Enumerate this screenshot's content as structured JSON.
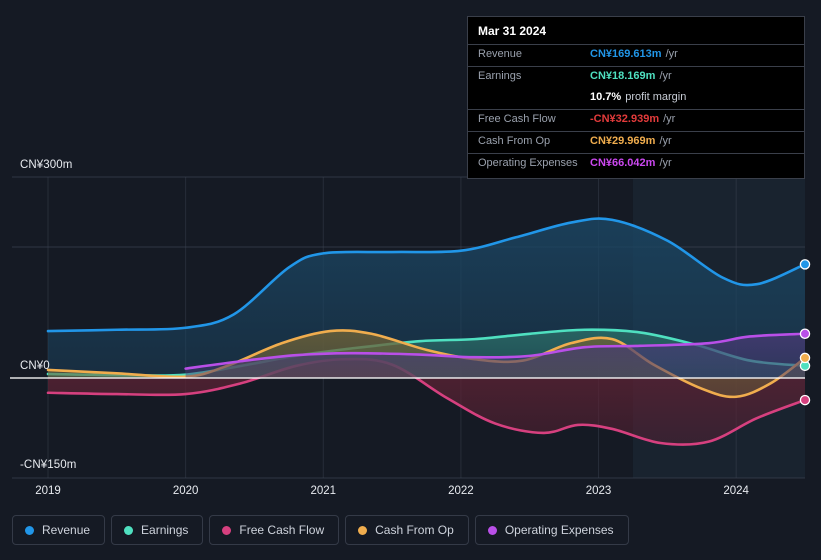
{
  "chart_data": {
    "type": "area",
    "title": "",
    "xlabel": "",
    "ylabel": "",
    "currency": "CN¥",
    "grid": true,
    "legend_position": "bottom",
    "x": [
      2019,
      2020,
      2021,
      2022,
      2023,
      2024
    ],
    "x_tick_labels": [
      "2019",
      "2020",
      "2021",
      "2022",
      "2023",
      "2024"
    ],
    "y_tick_labels": [
      "CN¥300m",
      "CN¥0",
      "-CN¥150m"
    ],
    "y_tick_values": [
      300,
      0,
      -150
    ],
    "ylim": [
      -150,
      300
    ],
    "zero_line": 0,
    "forecast_start": 2023.25,
    "series": [
      {
        "name": "Revenue",
        "color": "#2196e8",
        "fill": "#1b4562",
        "values": [
          70,
          75,
          186,
          190,
          236,
          169.613
        ],
        "points": [
          [
            2019.0,
            70
          ],
          [
            2019.5,
            72
          ],
          [
            2020.0,
            75
          ],
          [
            2020.35,
            95
          ],
          [
            2020.75,
            165
          ],
          [
            2021.0,
            186
          ],
          [
            2021.5,
            188
          ],
          [
            2022.0,
            190
          ],
          [
            2022.4,
            210
          ],
          [
            2022.8,
            232
          ],
          [
            2023.1,
            236
          ],
          [
            2023.5,
            205
          ],
          [
            2023.9,
            150
          ],
          [
            2024.15,
            140
          ],
          [
            2024.5,
            169.613
          ]
        ]
      },
      {
        "name": "Earnings",
        "color": "#4fe0c0",
        "fill": "#2a6b66",
        "values": [
          6,
          5,
          40,
          60,
          72,
          18.169
        ],
        "points": [
          [
            2019.0,
            6
          ],
          [
            2019.6,
            4
          ],
          [
            2020.0,
            5
          ],
          [
            2020.4,
            18
          ],
          [
            2020.8,
            33
          ],
          [
            2021.2,
            44
          ],
          [
            2021.7,
            55
          ],
          [
            2022.1,
            58
          ],
          [
            2022.5,
            66
          ],
          [
            2022.9,
            72
          ],
          [
            2023.3,
            68
          ],
          [
            2023.7,
            50
          ],
          [
            2024.1,
            26
          ],
          [
            2024.5,
            18.169
          ]
        ]
      },
      {
        "name": "Free Cash Flow",
        "color": "#d6407f",
        "fill": "#5c2234",
        "values": [
          -22,
          -24,
          28,
          -72,
          -95,
          -32.939
        ],
        "points": [
          [
            2019.0,
            -22
          ],
          [
            2019.5,
            -24
          ],
          [
            2020.0,
            -24
          ],
          [
            2020.4,
            -8
          ],
          [
            2020.8,
            18
          ],
          [
            2021.15,
            28
          ],
          [
            2021.5,
            20
          ],
          [
            2021.9,
            -30
          ],
          [
            2022.25,
            -68
          ],
          [
            2022.6,
            -82
          ],
          [
            2022.85,
            -70
          ],
          [
            2023.1,
            -76
          ],
          [
            2023.45,
            -97
          ],
          [
            2023.8,
            -95
          ],
          [
            2024.15,
            -60
          ],
          [
            2024.5,
            -32.939
          ]
        ]
      },
      {
        "name": "Cash From Op",
        "color": "#f0ad4e",
        "fill": "#6b6038",
        "values": [
          12,
          2,
          70,
          34,
          60,
          29.969
        ],
        "points": [
          [
            2019.0,
            12
          ],
          [
            2019.5,
            7
          ],
          [
            2020.0,
            2
          ],
          [
            2020.3,
            18
          ],
          [
            2020.7,
            52
          ],
          [
            2021.05,
            70
          ],
          [
            2021.35,
            66
          ],
          [
            2021.75,
            42
          ],
          [
            2022.1,
            28
          ],
          [
            2022.45,
            26
          ],
          [
            2022.8,
            52
          ],
          [
            2023.1,
            58
          ],
          [
            2023.4,
            20
          ],
          [
            2023.75,
            -16
          ],
          [
            2024.0,
            -28
          ],
          [
            2024.25,
            -8
          ],
          [
            2024.5,
            29.969
          ]
        ]
      },
      {
        "name": "Operating Expenses",
        "color": "#b94fe8",
        "fill": "#453a72",
        "values": [
          null,
          14,
          36,
          32,
          44,
          66.042
        ],
        "points": [
          [
            2020.0,
            14
          ],
          [
            2020.4,
            25
          ],
          [
            2020.8,
            34
          ],
          [
            2021.2,
            37
          ],
          [
            2021.7,
            35
          ],
          [
            2022.1,
            31
          ],
          [
            2022.5,
            33
          ],
          [
            2022.9,
            46
          ],
          [
            2023.3,
            48
          ],
          [
            2023.8,
            52
          ],
          [
            2024.1,
            62
          ],
          [
            2024.5,
            66.042
          ]
        ]
      }
    ]
  },
  "tooltip": {
    "date": "Mar 31 2024",
    "rows": [
      {
        "key": "Revenue",
        "value": "CN¥169.613m",
        "unit": "/yr",
        "color": "#2196e8",
        "sub": ""
      },
      {
        "key": "Earnings",
        "value": "CN¥18.169m",
        "unit": "/yr",
        "color": "#4fe0c0",
        "sub": ""
      },
      {
        "key": "",
        "value": "10.7%",
        "unit": "",
        "color": "#ffffff",
        "sub": "profit margin"
      },
      {
        "key": "Free Cash Flow",
        "value": "-CN¥32.939m",
        "unit": "/yr",
        "color": "#e33b3b",
        "sub": ""
      },
      {
        "key": "Cash From Op",
        "value": "CN¥29.969m",
        "unit": "/yr",
        "color": "#f0ad4e",
        "sub": ""
      },
      {
        "key": "Operating Expenses",
        "value": "CN¥66.042m",
        "unit": "/yr",
        "color": "#cc48f0",
        "sub": ""
      }
    ]
  },
  "legend": {
    "items": [
      {
        "label": "Revenue",
        "color": "#2196e8"
      },
      {
        "label": "Earnings",
        "color": "#4fe0c0"
      },
      {
        "label": "Free Cash Flow",
        "color": "#d6407f"
      },
      {
        "label": "Cash From Op",
        "color": "#f0ad4e"
      },
      {
        "label": "Operating Expenses",
        "color": "#b94fe8"
      }
    ]
  }
}
